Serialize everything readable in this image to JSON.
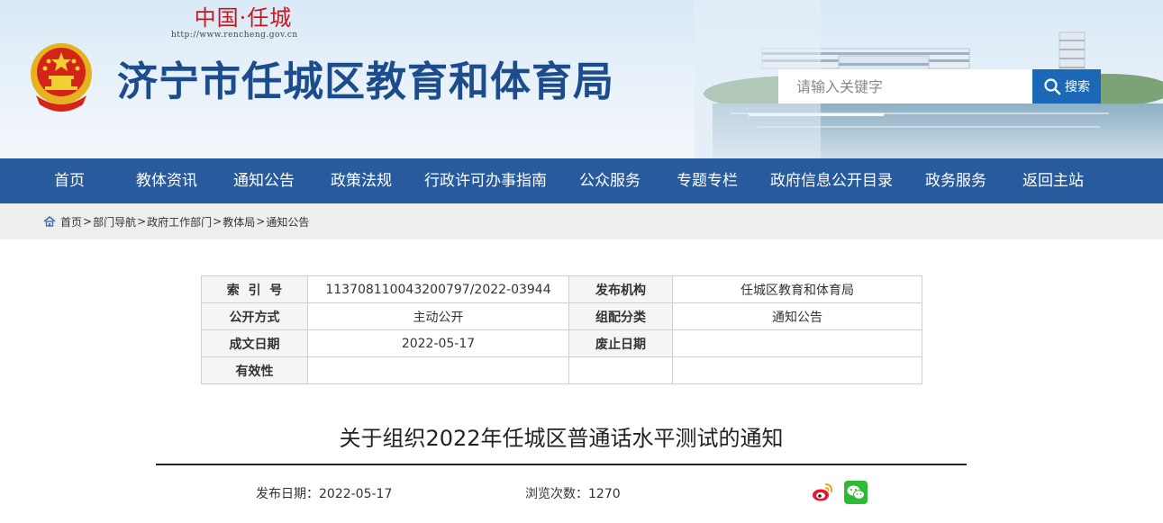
{
  "header": {
    "site_brand": "中国·任城",
    "site_url": "http://www.rencheng.gov.cn",
    "title": "济宁市任城区教育和体育局",
    "search_placeholder": "请输入关键字",
    "search_button": "搜索"
  },
  "nav": {
    "items": [
      {
        "label": "首页"
      },
      {
        "label": "教体资讯"
      },
      {
        "label": "通知公告"
      },
      {
        "label": "政策法规"
      },
      {
        "label": "行政许可办事指南"
      },
      {
        "label": "公众服务"
      },
      {
        "label": "专题专栏"
      },
      {
        "label": "政府信息公开目录"
      },
      {
        "label": "政务服务"
      },
      {
        "label": "返回主站"
      }
    ]
  },
  "breadcrumb": {
    "items": [
      "首页",
      "部门导航",
      "政府工作部门",
      "教体局",
      "通知公告"
    ],
    "separator": ">"
  },
  "meta": {
    "rows": [
      {
        "k1": "索  引  号",
        "v1": "113708110043200797/2022-03944",
        "k2": "发布机构",
        "v2": "任城区教育和体育局"
      },
      {
        "k1": "公开方式",
        "v1": "主动公开",
        "k2": "组配分类",
        "v2": "通知公告"
      },
      {
        "k1": "成文日期",
        "v1": "2022-05-17",
        "k2": "废止日期",
        "v2": ""
      },
      {
        "k1": "有效性",
        "v1": "",
        "k2": "",
        "v2": ""
      }
    ]
  },
  "article": {
    "title": "关于组织2022年任城区普通话水平测试的通知",
    "publish_date": "发布日期：2022-05-17",
    "views": "浏览次数：1270"
  },
  "share": {
    "icons": [
      "weibo-icon",
      "wechat-icon"
    ]
  },
  "colors": {
    "nav_bg": "#285a9e",
    "title_blue": "#1d4c8c",
    "search_btn": "#1b69b6",
    "brand_red": "#c8161d",
    "crumb_bg": "#eeeeee"
  }
}
